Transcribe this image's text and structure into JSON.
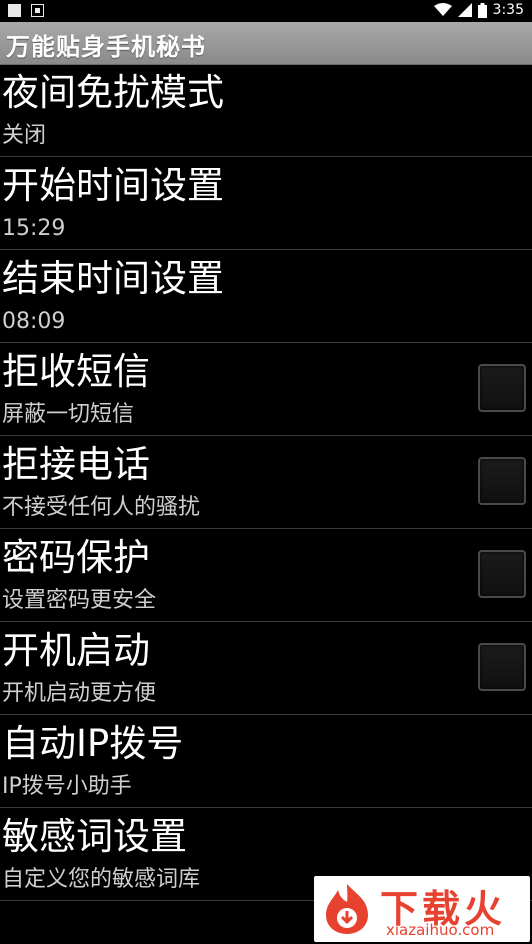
{
  "status_bar": {
    "time": "3:35",
    "icons": [
      "notification-square-icon",
      "notification-app-icon",
      "wifi-icon",
      "cell-signal-icon",
      "battery-icon"
    ]
  },
  "app": {
    "title": "万能贴身手机秘书"
  },
  "settings": [
    {
      "label": "夜间免扰模式",
      "summary": "关闭"
    },
    {
      "label": "开始时间设置",
      "summary": "15:29"
    },
    {
      "label": "结束时间设置",
      "summary": "08:09"
    },
    {
      "label": "拒收短信",
      "summary": "屏蔽一切短信",
      "checked": false
    },
    {
      "label": "拒接电话",
      "summary": "不接受任何人的骚扰",
      "checked": false
    },
    {
      "label": "密码保护",
      "summary": "设置密码更安全",
      "checked": false
    },
    {
      "label": "开机启动",
      "summary": "开机启动更方便",
      "checked": false
    },
    {
      "label": "自动IP拨号",
      "summary": "IP拨号小助手"
    },
    {
      "label": "敏感词设置",
      "summary": "自定义您的敏感词库"
    }
  ],
  "watermark": {
    "text": "下载火",
    "domain": "xiazaihuo.com",
    "color": "#e7422f"
  },
  "colors": {
    "background": "#000000",
    "title_bar": "#9a9a9a",
    "divider": "#3a3a3a"
  }
}
